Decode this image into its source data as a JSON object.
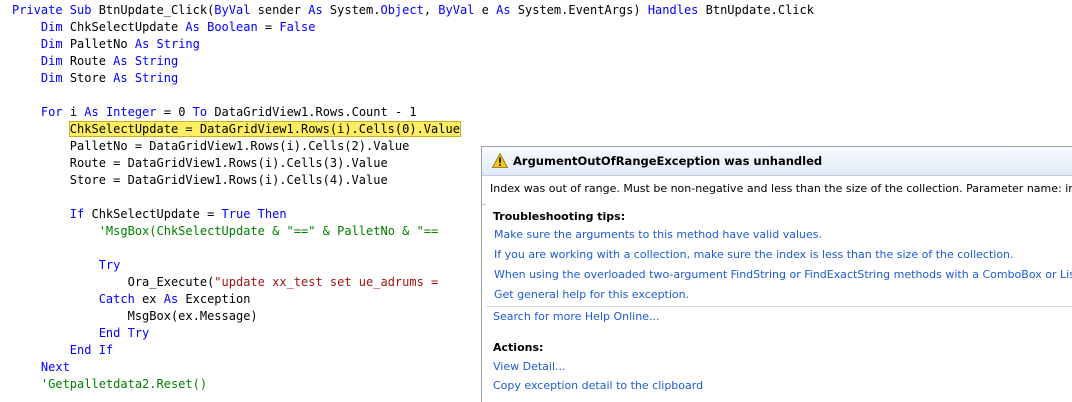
{
  "code": {
    "lines": [
      [
        {
          "t": "Private Sub ",
          "c": "kw"
        },
        {
          "t": "BtnUpdate_Click(",
          "c": ""
        },
        {
          "t": "ByVal",
          "c": "kw"
        },
        {
          "t": " sender ",
          "c": ""
        },
        {
          "t": "As",
          "c": "kw"
        },
        {
          "t": " System.",
          "c": ""
        },
        {
          "t": "Object",
          "c": "kw"
        },
        {
          "t": ", ",
          "c": ""
        },
        {
          "t": "ByVal",
          "c": "kw"
        },
        {
          "t": " e ",
          "c": ""
        },
        {
          "t": "As",
          "c": "kw"
        },
        {
          "t": " System.EventArgs) ",
          "c": ""
        },
        {
          "t": "Handles",
          "c": "kw"
        },
        {
          "t": " BtnUpdate.Click",
          "c": ""
        }
      ],
      [
        {
          "t": "    ",
          "c": ""
        },
        {
          "t": "Dim",
          "c": "kw"
        },
        {
          "t": " ChkSelectUpdate ",
          "c": ""
        },
        {
          "t": "As Boolean",
          "c": "kw"
        },
        {
          "t": " = ",
          "c": ""
        },
        {
          "t": "False",
          "c": "kw"
        }
      ],
      [
        {
          "t": "    ",
          "c": ""
        },
        {
          "t": "Dim",
          "c": "kw"
        },
        {
          "t": " PalletNo ",
          "c": ""
        },
        {
          "t": "As String",
          "c": "kw"
        }
      ],
      [
        {
          "t": "    ",
          "c": ""
        },
        {
          "t": "Dim",
          "c": "kw"
        },
        {
          "t": " Route ",
          "c": ""
        },
        {
          "t": "As String",
          "c": "kw"
        }
      ],
      [
        {
          "t": "    ",
          "c": ""
        },
        {
          "t": "Dim",
          "c": "kw"
        },
        {
          "t": " Store ",
          "c": ""
        },
        {
          "t": "As String",
          "c": "kw"
        }
      ],
      [],
      [
        {
          "t": "    ",
          "c": ""
        },
        {
          "t": "For",
          "c": "kw"
        },
        {
          "t": " i ",
          "c": ""
        },
        {
          "t": "As Integer",
          "c": "kw"
        },
        {
          "t": " = 0 ",
          "c": ""
        },
        {
          "t": "To",
          "c": "kw"
        },
        {
          "t": " DataGridView1.Rows.Count - 1",
          "c": ""
        }
      ],
      [
        {
          "t": "        ",
          "c": ""
        },
        {
          "t": "ChkSelectUpdate = DataGridView1.Rows(i).Cells(0).Value",
          "c": "hl"
        }
      ],
      [
        {
          "t": "        PalletNo = DataGridView1.Rows(i).Cells(2).Value",
          "c": ""
        }
      ],
      [
        {
          "t": "        Route = DataGridView1.Rows(i).Cells(3).Value",
          "c": ""
        }
      ],
      [
        {
          "t": "        Store = DataGridView1.Rows(i).Cells(4).Value",
          "c": ""
        }
      ],
      [],
      [
        {
          "t": "        ",
          "c": ""
        },
        {
          "t": "If",
          "c": "kw"
        },
        {
          "t": " ChkSelectUpdate = ",
          "c": ""
        },
        {
          "t": "True Then",
          "c": "kw"
        }
      ],
      [
        {
          "t": "            ",
          "c": ""
        },
        {
          "t": "'MsgBox(ChkSelectUpdate & \"==\" & PalletNo & \"==",
          "c": "cm"
        }
      ],
      [],
      [
        {
          "t": "            ",
          "c": ""
        },
        {
          "t": "Try",
          "c": "kw"
        }
      ],
      [
        {
          "t": "                Ora_Execute(",
          "c": ""
        },
        {
          "t": "\"update xx_test set ue_adrums =",
          "c": "st"
        }
      ],
      [
        {
          "t": "            ",
          "c": ""
        },
        {
          "t": "Catch",
          "c": "kw"
        },
        {
          "t": " ex ",
          "c": ""
        },
        {
          "t": "As",
          "c": "kw"
        },
        {
          "t": " Exception",
          "c": ""
        }
      ],
      [
        {
          "t": "                MsgBox(ex.Message)",
          "c": ""
        }
      ],
      [
        {
          "t": "            ",
          "c": ""
        },
        {
          "t": "End Try",
          "c": "kw"
        }
      ],
      [
        {
          "t": "        ",
          "c": ""
        },
        {
          "t": "End If",
          "c": "kw"
        }
      ],
      [
        {
          "t": "    ",
          "c": ""
        },
        {
          "t": "Next",
          "c": "kw"
        }
      ],
      [
        {
          "t": "    ",
          "c": ""
        },
        {
          "t": "'Getpalletdata2.Reset()",
          "c": "cm"
        }
      ]
    ]
  },
  "exception_helper": {
    "icon": "warning-icon",
    "title": "ArgumentOutOfRangeException was unhandled",
    "message": "Index was out of range. Must be non-negative and less than the size of the collection. Parameter name: index",
    "tips_heading": "Troubleshooting tips:",
    "tips": [
      "Make sure the arguments to this method have valid values.",
      "If you are working with a collection, make sure the index is less than the size of the collection.",
      "When using the overloaded two-argument FindString or FindExactString methods with a ComboBox or ListBox, check the",
      "Get general help for this exception."
    ],
    "search_link": "Search for more Help Online...",
    "actions_heading": "Actions:",
    "actions": [
      "View Detail...",
      "Copy exception detail to the clipboard"
    ]
  },
  "colors": {
    "keyword": "#0000ff",
    "comment": "#008000",
    "string": "#a31515",
    "highlight": "#ffee62",
    "link": "#1c5bd6"
  }
}
